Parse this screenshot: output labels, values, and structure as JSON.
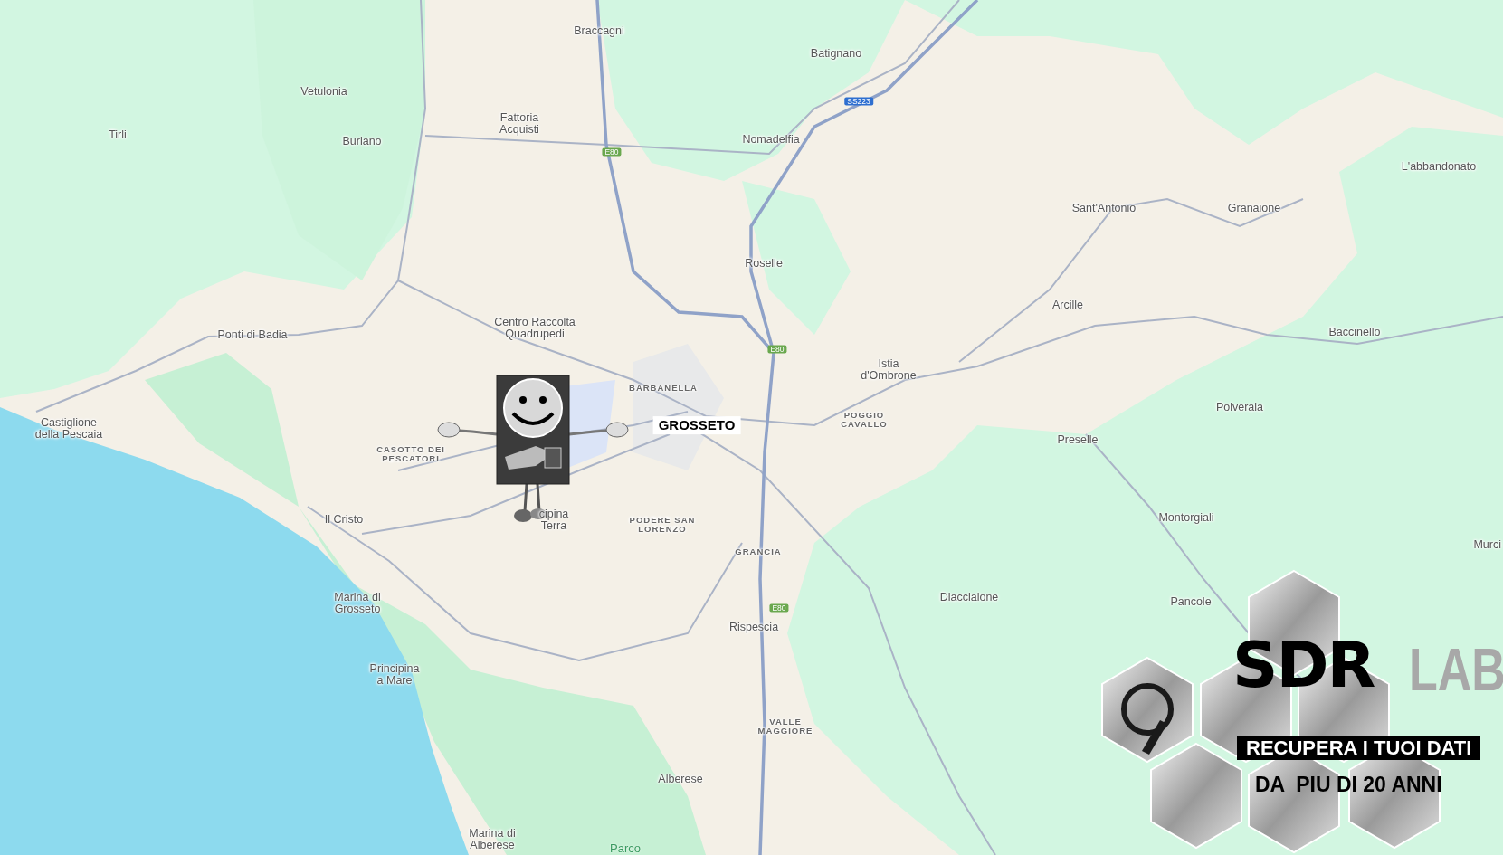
{
  "map": {
    "labels": [
      {
        "kind": "town",
        "text": "Braccagni"
      },
      {
        "kind": "town",
        "text": "Batignano"
      },
      {
        "kind": "town",
        "text": "Vetulonia"
      },
      {
        "kind": "town",
        "text": "Tirli"
      },
      {
        "kind": "town",
        "text": "Buriano"
      },
      {
        "kind": "town",
        "text": "Fattoria\nAcquisti"
      },
      {
        "kind": "town",
        "text": "Nomadelfia"
      },
      {
        "kind": "town",
        "text": "L'abbandonato"
      },
      {
        "kind": "town",
        "text": "Sant'Antonio"
      },
      {
        "kind": "town",
        "text": "Granaione"
      },
      {
        "kind": "town",
        "text": "Roselle"
      },
      {
        "kind": "town",
        "text": "Arcille"
      },
      {
        "kind": "town",
        "text": "Ponti di Badia"
      },
      {
        "kind": "town",
        "text": "Centro Raccolta\nQuadrupedi"
      },
      {
        "kind": "town",
        "text": "Baccinello"
      },
      {
        "kind": "town",
        "text": "Istia\nd'Ombrone"
      },
      {
        "kind": "district",
        "text": "BARBANELLA"
      },
      {
        "kind": "town",
        "text": "Castiglione\ndella Pescaia"
      },
      {
        "kind": "city",
        "text": "GROSSETO"
      },
      {
        "kind": "district",
        "text": "POGGIO\nCAVALLO"
      },
      {
        "kind": "town",
        "text": "Polveraia"
      },
      {
        "kind": "district",
        "text": "CASOTTO DEI\nPESCATORI"
      },
      {
        "kind": "town",
        "text": "Preselle"
      },
      {
        "kind": "town",
        "text": "Il Cristo"
      },
      {
        "kind": "town",
        "text": "cipina\nTerra"
      },
      {
        "kind": "district",
        "text": "PODERE SAN\nLORENZO"
      },
      {
        "kind": "town",
        "text": "Montorgiali"
      },
      {
        "kind": "district",
        "text": "GRANCIA"
      },
      {
        "kind": "town",
        "text": "Murci"
      },
      {
        "kind": "town",
        "text": "Marina di\nGrosseto"
      },
      {
        "kind": "town",
        "text": "Diaccialone"
      },
      {
        "kind": "town",
        "text": "Pancole"
      },
      {
        "kind": "town",
        "text": "Rispescia"
      },
      {
        "kind": "town",
        "text": "Principina\na Mare"
      },
      {
        "kind": "district",
        "text": "VALLE\nMAGGIORE"
      },
      {
        "kind": "town",
        "text": "Alberese"
      },
      {
        "kind": "town",
        "text": "Marina di\nAlberese"
      },
      {
        "kind": "park",
        "text": "Parco"
      }
    ],
    "road_shields": [
      {
        "kind": "european-road",
        "text": "E80"
      },
      {
        "kind": "state-road",
        "text": "SS223"
      },
      {
        "kind": "european-road",
        "text": "E80"
      },
      {
        "kind": "european-road",
        "text": "E80"
      }
    ]
  },
  "logo": {
    "name": "SDR",
    "suffix": "LAB",
    "tagline": "RECUPERA I TUOI DATI",
    "since": "DA  PIU DI 20 ANNI"
  }
}
